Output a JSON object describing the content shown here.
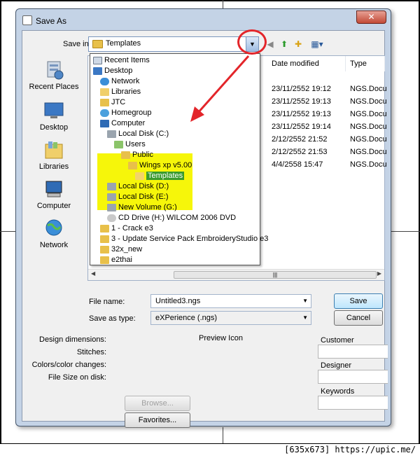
{
  "dialog": {
    "title": "Save As",
    "close_glyph": "✕"
  },
  "toolbar": {
    "save_in_label": "Save in:",
    "current_folder": "Templates"
  },
  "places": [
    {
      "label": "Recent Places",
      "icon": "recent-places-icon"
    },
    {
      "label": "Desktop",
      "icon": "desktop-icon"
    },
    {
      "label": "Libraries",
      "icon": "libraries-icon"
    },
    {
      "label": "Computer",
      "icon": "computer-icon"
    },
    {
      "label": "Network",
      "icon": "network-icon"
    }
  ],
  "file_list": {
    "columns": [
      "Date modified",
      "Type"
    ],
    "rows": [
      {
        "date": "23/11/2552 19:12",
        "type": "NGS.Docu"
      },
      {
        "date": "23/11/2552 19:13",
        "type": "NGS.Docu"
      },
      {
        "date": "23/11/2552 19:13",
        "type": "NGS.Docu"
      },
      {
        "date": "23/11/2552 19:14",
        "type": "NGS.Docu"
      },
      {
        "date": "2/12/2552 21:52",
        "type": "NGS.Docu"
      },
      {
        "date": "2/12/2552 21:53",
        "type": "NGS.Docu"
      },
      {
        "date": "4/4/2558 15:47",
        "type": "NGS.Docu"
      }
    ]
  },
  "dropdown_items": [
    {
      "label": "Recent Items",
      "icon": "recent-items-icon"
    },
    {
      "label": "Desktop",
      "icon": "desktop-icon"
    },
    {
      "label": "Network",
      "icon": "network-icon"
    },
    {
      "label": "Libraries",
      "icon": "libraries-icon"
    },
    {
      "label": "JTC",
      "icon": "user-folder-icon"
    },
    {
      "label": "Homegroup",
      "icon": "homegroup-icon"
    },
    {
      "label": "Computer",
      "icon": "computer-icon"
    },
    {
      "label": "Local Disk (C:)",
      "icon": "drive-icon"
    },
    {
      "label": "Users",
      "icon": "users-icon"
    },
    {
      "label": "Public",
      "icon": "folder-icon"
    },
    {
      "label": "Wings xp v5.00",
      "icon": "folder-icon"
    },
    {
      "label": "Templates",
      "icon": "folder-open-icon"
    },
    {
      "label": "Local Disk (D:)",
      "icon": "drive-icon"
    },
    {
      "label": "Local Disk (E:)",
      "icon": "drive-icon"
    },
    {
      "label": "New Volume (G:)",
      "icon": "drive-icon"
    },
    {
      "label": "CD Drive (H:) WILCOM 2006 DVD",
      "icon": "cd-drive-icon"
    },
    {
      "label": "1 - Crack e3",
      "icon": "folder-icon"
    },
    {
      "label": "3 - Update Service Pack EmbroideryStudio e3",
      "icon": "folder-icon"
    },
    {
      "label": "32x_new",
      "icon": "folder-icon"
    },
    {
      "label": "e2thai",
      "icon": "folder-icon"
    }
  ],
  "form": {
    "file_name_label": "File name:",
    "file_name_value": "Untitled3.ngs",
    "save_type_label": "Save as type:",
    "save_type_value": "eXPerience (.ngs)",
    "save_button": "Save",
    "cancel_button": "Cancel"
  },
  "details": {
    "design_dimensions": "Design dimensions:",
    "stitches": "Stitches:",
    "colors": "Colors/color changes:",
    "file_size": "File Size on disk:",
    "preview_icon": "Preview Icon",
    "customer": "Customer",
    "designer": "Designer",
    "keywords": "Keywords",
    "browse_button": "Browse...",
    "favorites_button": "Favorites..."
  },
  "footer": {
    "caption": "[635x673] https://upic.me/"
  },
  "colors": {
    "highlight_yellow": "#f6f60a",
    "selection_green": "#3a9b2d",
    "annotation_red": "#e3252a"
  }
}
